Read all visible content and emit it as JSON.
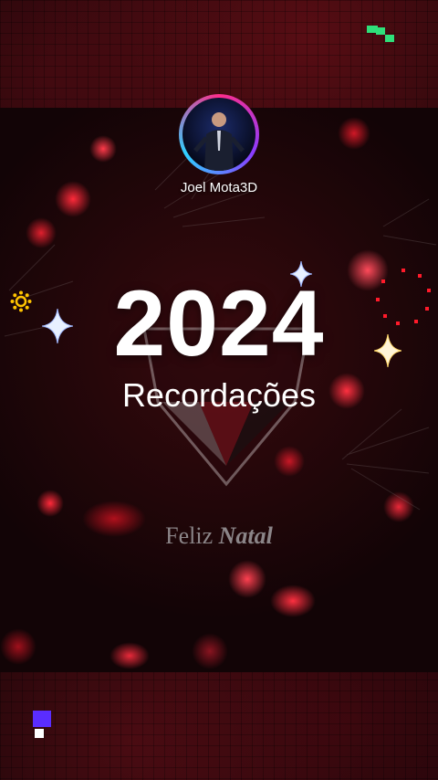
{
  "post": {
    "username": "Joel Mota3D",
    "year": "2024",
    "subtitle": "Recordações",
    "greeting_word1": "Feliz",
    "greeting_word2": "Natal"
  },
  "icons": {
    "top_right": "brand-logo-icon",
    "bottom_left": "brand-logo-icon",
    "sparkles": "sparkle-icon",
    "sun": "sun-icon",
    "dotted_ring": "dotted-circle-icon"
  },
  "colors": {
    "accent_green": "#2fe07a",
    "accent_purple": "#5a2dff",
    "bokeh_red": "#e0202e",
    "sparkle_gold": "#ffd86a",
    "ring_pink": "#ff2d8a",
    "ring_blue": "#2fd0ff"
  }
}
